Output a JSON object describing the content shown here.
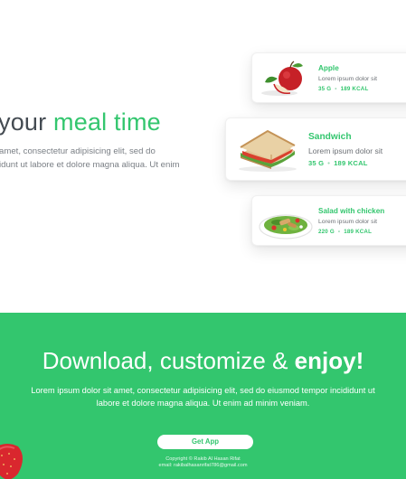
{
  "hero": {
    "title_prefix": "your ",
    "title_accent": "meal time",
    "subtitle_line1": "amet, consectetur adipisicing elit, sed do",
    "subtitle_line2": "idunt ut labore et dolore magna aliqua. Ut enim"
  },
  "cards": [
    {
      "title": "Apple",
      "description": "Lorem ipsum dolor sit",
      "weight": "35 G",
      "separator": "•",
      "calories": "189 KCAL",
      "icon": "apple-image"
    },
    {
      "title": "Sandwich",
      "description": "Lorem ipsum dolor sit",
      "weight": "35 G",
      "separator": "•",
      "calories": "189 KCAL",
      "icon": "sandwich-image"
    },
    {
      "title": "Salad with chicken",
      "description": "Lorem ipsum dolor sit",
      "weight": "220 G",
      "separator": "•",
      "calories": "189 KCAL",
      "icon": "salad-image"
    }
  ],
  "download": {
    "title_prefix": "Download, customize & ",
    "title_bold": "enjoy!",
    "text_line1": "Lorem ipsum dolor sit amet, consectetur adipisicing elit, sed do eiusmod tempor incididunt ut",
    "text_line2": "labore et dolore magna aliqua. Ut enim ad minim veniam.",
    "button_label": "Get App"
  },
  "footer": {
    "copyright": "Copyright © Rakib Al Hasan Rifat",
    "email": "email: rakibalhasanrifat786@gmail.com"
  },
  "colors": {
    "accent": "#33c66e",
    "text_dark": "#444b52",
    "text_muted": "#7a7f85",
    "background": "#ffffff"
  }
}
